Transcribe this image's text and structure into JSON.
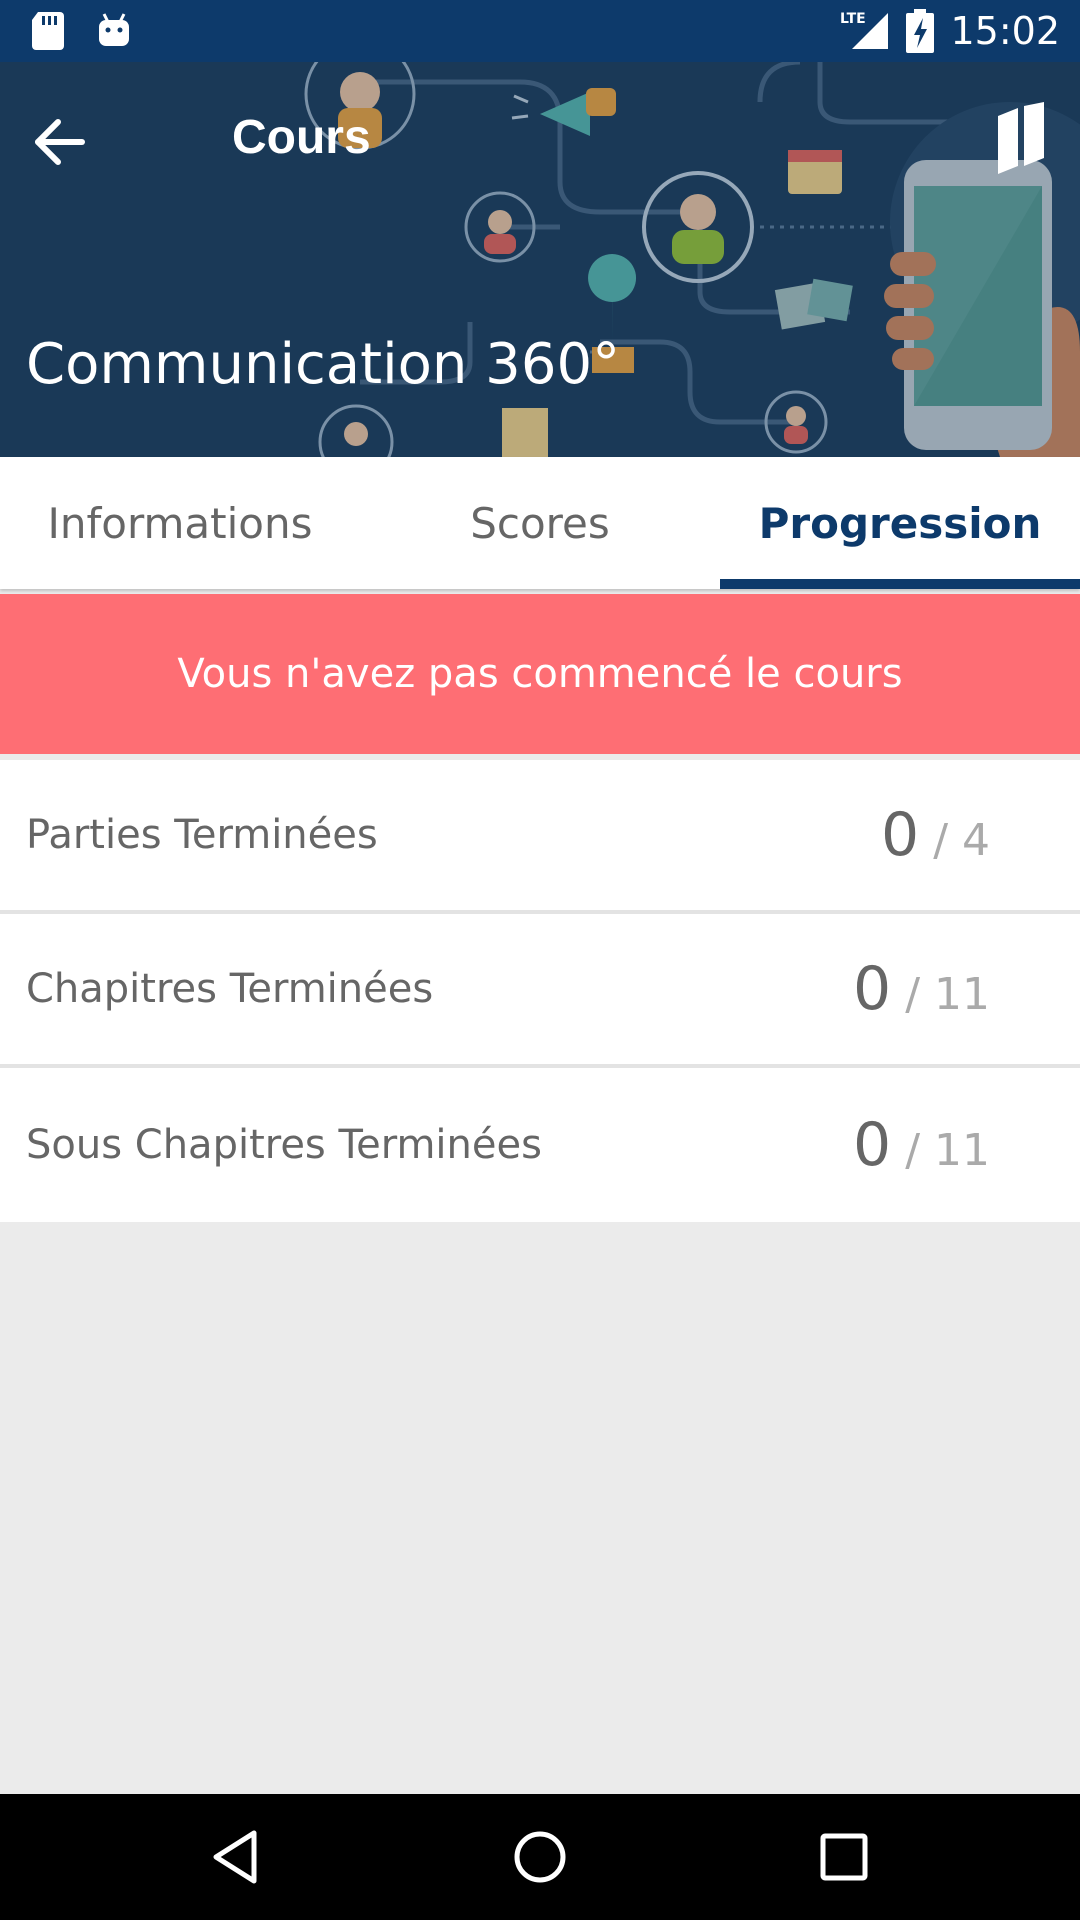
{
  "status_bar": {
    "time": "15:02",
    "network": "LTE",
    "icons": [
      "sd-card-icon",
      "android-icon",
      "lte-signal-icon",
      "battery-charging-icon"
    ]
  },
  "header": {
    "title": "Cours",
    "course_title": "Communication 360°"
  },
  "tabs": [
    {
      "label": "Informations",
      "active": false
    },
    {
      "label": "Scores",
      "active": false
    },
    {
      "label": "Progression",
      "active": true
    }
  ],
  "banner": {
    "text": "Vous n'avez pas commencé le cours"
  },
  "progress_rows": [
    {
      "label": "Parties Terminées",
      "done": "0",
      "total": "/ 4"
    },
    {
      "label": "Chapitres Terminées",
      "done": "0",
      "total": "/ 11"
    },
    {
      "label": "Sous Chapitres Terminées",
      "done": "0",
      "total": "/ 11"
    }
  ],
  "colors": {
    "primary": "#0d3a6b",
    "banner": "#fe6e74",
    "background": "#ebebeb"
  }
}
